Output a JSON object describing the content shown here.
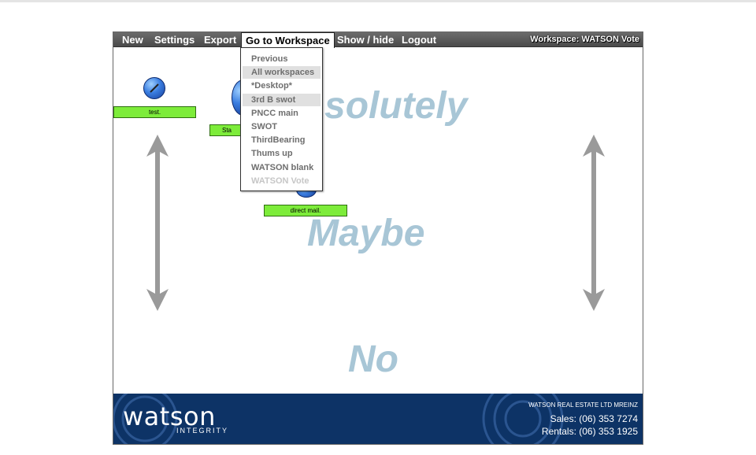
{
  "menubar": {
    "items": [
      "New",
      "Settings",
      "Export",
      "Go to Workspace",
      "Show / hide",
      "Logout"
    ],
    "workspace_label": "Workspace: WATSON Vote"
  },
  "workspace_menu": {
    "items": [
      {
        "label": "Previous",
        "state": "normal"
      },
      {
        "label": "All workspaces",
        "state": "highlighted"
      },
      {
        "label": "*Desktop*",
        "state": "normal"
      },
      {
        "label": "3rd B swot",
        "state": "highlighted"
      },
      {
        "label": "PNCC main",
        "state": "normal"
      },
      {
        "label": "SWOT",
        "state": "normal"
      },
      {
        "label": "ThirdBearing",
        "state": "normal"
      },
      {
        "label": "Thums up",
        "state": "normal"
      },
      {
        "label": "WATSON blank",
        "state": "normal"
      },
      {
        "label": "WATSON Vote",
        "state": "disabled"
      }
    ]
  },
  "canvas": {
    "zones": [
      "solutely",
      "Maybe",
      "No"
    ],
    "nodes": [
      {
        "label": "test."
      },
      {
        "label": "Sta"
      },
      {
        "label": "direct mail."
      }
    ]
  },
  "footer": {
    "logo": "watson",
    "logo_sub": "INTEGRITY",
    "company": "WATSON REAL ESTATE LTD MREINZ",
    "sales": "Sales: (06) 353 7274",
    "rentals": "Rentals: (06) 353 1925"
  },
  "colors": {
    "menubar": "#5a5a5a",
    "node_label": "#7dec3a",
    "zone_text": "#a8c6d6",
    "footer": "#0d3366",
    "arrow": "#9a9a9a"
  }
}
